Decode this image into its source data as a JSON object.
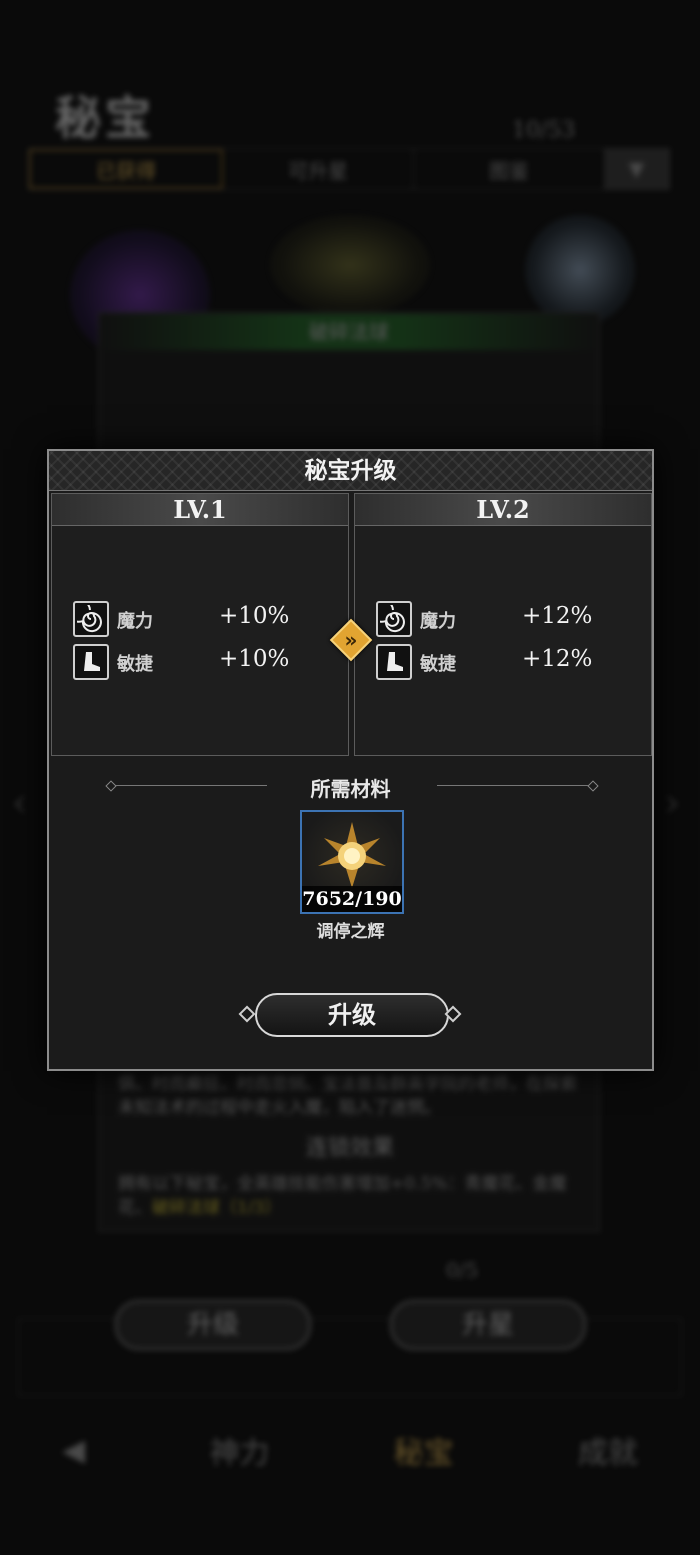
{
  "background": {
    "title": "秘宝",
    "count": "10/53",
    "tabs": [
      "已获得",
      "可升星",
      "图鉴"
    ],
    "panel_title": "破碎法球",
    "lore": "俱、时而癫狂、时而悲悯、宝法普及群英学院的老师，在探索未知法术的过程中走火入魔，陷入了迷惘。",
    "chain_title": "连锁效果",
    "chain_desc": "拥有以下秘宝，全英雄技能伤害增加+0.5%：青魔花、金魔花、",
    "chain_highlight": "破碎法球（1/3）",
    "stars": "0/5",
    "upgrade_button": "升级",
    "star_button": "升星",
    "nav": [
      "神力",
      "秘宝",
      "成就"
    ]
  },
  "dialog": {
    "title": "秘宝升级",
    "current": {
      "level": "LV.1",
      "stats": [
        {
          "icon": "spiral-icon",
          "name": "魔力",
          "value": "+10%"
        },
        {
          "icon": "boot-icon",
          "name": "敏捷",
          "value": "+10%"
        }
      ]
    },
    "next": {
      "level": "LV.2",
      "stats": [
        {
          "icon": "spiral-icon",
          "name": "魔力",
          "value": "+12%"
        },
        {
          "icon": "boot-icon",
          "name": "敏捷",
          "value": "+12%"
        }
      ]
    },
    "arrow_icon": "double-chevron-right-icon",
    "materials_title": "所需材料",
    "material": {
      "name": "调停之辉",
      "count": "7652/190",
      "icon": "radiant-star-icon"
    },
    "upgrade_button": "升级"
  },
  "colors": {
    "accent": "#e2a431",
    "item_border": "#3c73b3",
    "active_tab": "#c9a24b"
  }
}
